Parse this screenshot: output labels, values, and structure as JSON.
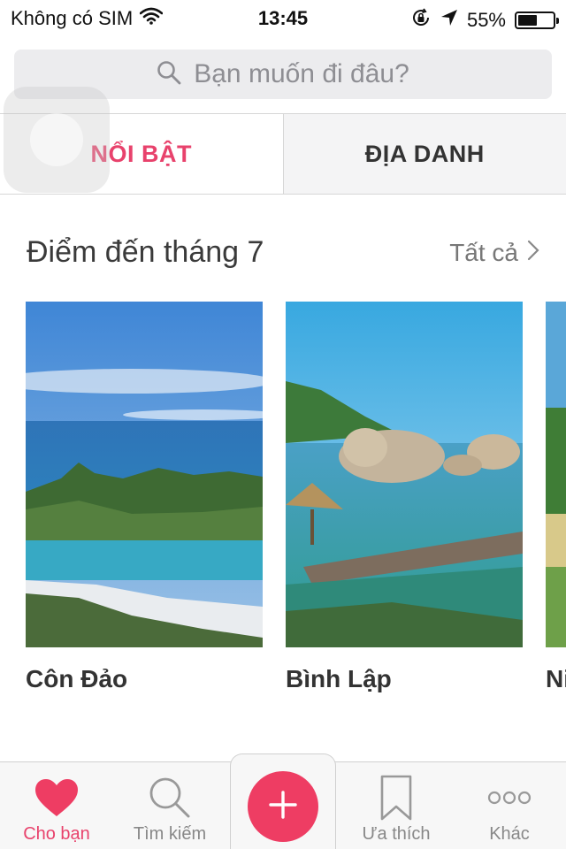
{
  "status_bar": {
    "carrier": "Không có SIM",
    "time": "13:45",
    "battery_text": "55%",
    "battery_level": 0.55,
    "icons": [
      "wifi-icon",
      "orientation-lock-icon",
      "location-arrow-icon",
      "battery-icon"
    ]
  },
  "search": {
    "placeholder": "Bạn muốn đi đâu?"
  },
  "tabs": [
    {
      "label": "NỔI BẬT",
      "active": true
    },
    {
      "label": "ĐỊA DANH",
      "active": false
    }
  ],
  "section": {
    "title": "Điểm đến tháng 7",
    "see_all": "Tất cả"
  },
  "destinations": [
    {
      "name": "Côn Đảo"
    },
    {
      "name": "Bình Lập"
    },
    {
      "name": "Ni"
    }
  ],
  "tabbar": {
    "items": [
      {
        "label": "Cho bạn",
        "icon": "heart-icon",
        "active": true
      },
      {
        "label": "Tìm kiếm",
        "icon": "search-icon",
        "active": false
      },
      {
        "label": "",
        "icon": "plus-icon",
        "active": false
      },
      {
        "label": "Ưa thích",
        "icon": "bookmark-icon",
        "active": false
      },
      {
        "label": "Khác",
        "icon": "more-dots-icon",
        "active": false
      }
    ]
  },
  "colors": {
    "accent": "#e8426c",
    "fab": "#ee3d63",
    "text_dark": "#333333",
    "text_muted": "#888888"
  }
}
